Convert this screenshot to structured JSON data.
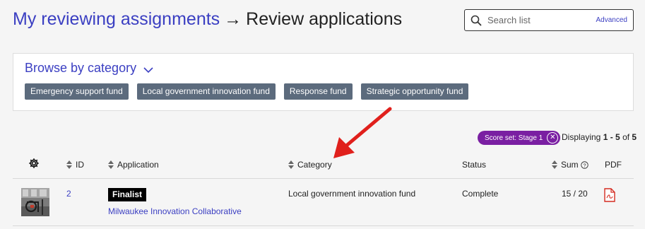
{
  "header": {
    "breadcrumb_link": "My reviewing assignments",
    "separator": "→",
    "current": "Review applications"
  },
  "search": {
    "placeholder": "Search list",
    "advanced_label": "Advanced"
  },
  "browse": {
    "title": "Browse by category",
    "categories": [
      "Emergency support fund",
      "Local government innovation fund",
      "Response fund",
      "Strategic opportunity fund"
    ]
  },
  "filter": {
    "chip_label": "Score set: Stage 1",
    "displaying_prefix": "Displaying",
    "range": "1 - 5",
    "of_label": "of",
    "total": "5",
    "chip_color": "#7a1fa2"
  },
  "table": {
    "columns": {
      "settings_icon": "gear-icon",
      "id": "ID",
      "application": "Application",
      "category": "Category",
      "status": "Status",
      "sum": "Sum",
      "pdf": "PDF"
    },
    "rows": [
      {
        "id": "2",
        "badge": "Finalist",
        "application": "Milwaukee Innovation Collaborative",
        "category": "Local government innovation fund",
        "status": "Complete",
        "sum": "15 / 20",
        "pdf_icon": "pdf-file-icon"
      }
    ]
  },
  "colors": {
    "link": "#3b3fc2",
    "pill": "#5c6b7d",
    "annotation_arrow": "#e0201c"
  }
}
